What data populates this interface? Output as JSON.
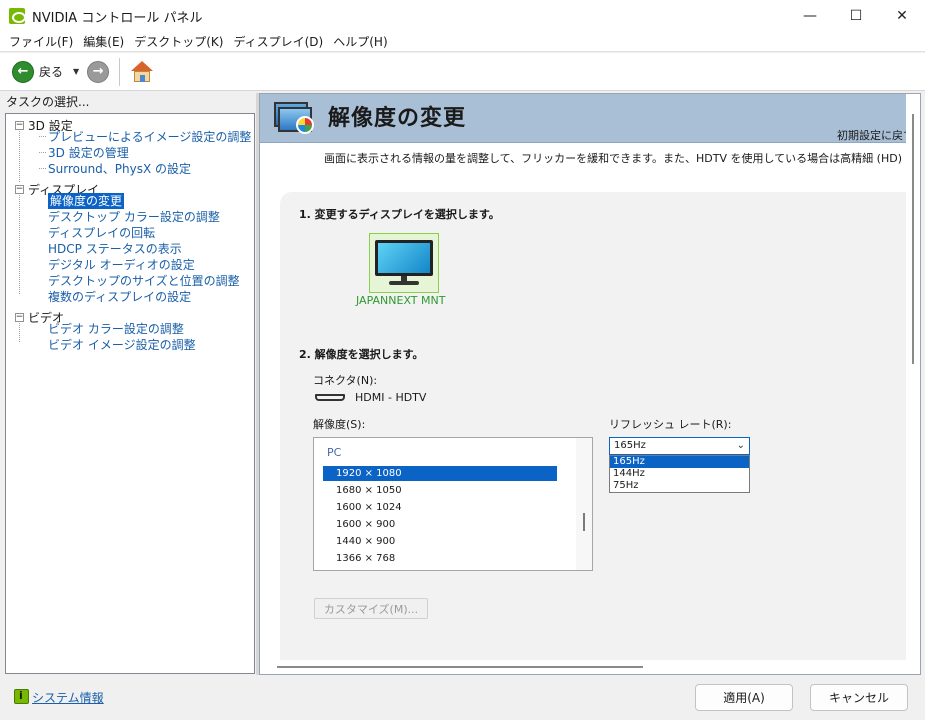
{
  "window": {
    "title": "NVIDIA コントロール パネル",
    "minimize": "—",
    "maximize": "☐",
    "close": "✕"
  },
  "menu": [
    "ファイル(F)",
    "編集(E)",
    "デスクトップ(K)",
    "ディスプレイ(D)",
    "ヘルプ(H)"
  ],
  "toolbar": {
    "back_label": "戻る",
    "back_arrow": "←",
    "forward_arrow": "→",
    "dropdown_caret": "▼"
  },
  "left_panel": {
    "header": "タスクの選択...",
    "groups": [
      {
        "label": "3D 設定",
        "expander": "−",
        "items": [
          "プレビューによるイメージ設定の調整",
          "3D 設定の管理",
          "Surround、PhysX の設定"
        ]
      },
      {
        "label": "ディスプレイ",
        "expander": "−",
        "items": [
          "解像度の変更",
          "デスクトップ カラー設定の調整",
          "ディスプレイの回転",
          "HDCP ステータスの表示",
          "デジタル オーディオの設定",
          "デスクトップのサイズと位置の調整",
          "複数のディスプレイの設定"
        ]
      },
      {
        "label": "ビデオ",
        "expander": "−",
        "items": [
          "ビデオ カラー設定の調整",
          "ビデオ イメージ設定の調整"
        ]
      }
    ],
    "selected_item": "解像度の変更"
  },
  "page": {
    "title": "解像度の変更",
    "restore_defaults": "初期設定に戻す",
    "description": "画面に表示される情報の量を調整して、フリッカーを緩和できます。また、HDTV を使用している場合は高精細 (HD) 方式を選",
    "step1": "1. 変更するディスプレイを選択します。",
    "display_name": "JAPANNEXT MNT",
    "step2": "2. 解像度を選択します。",
    "connector_label": "コネクタ(N):",
    "connector_value": "HDMI - HDTV",
    "resolution_label": "解像度(S):",
    "resolution_group": "PC",
    "resolutions": [
      "1920 × 1080",
      "1680 × 1050",
      "1600 × 1024",
      "1600 × 900",
      "1440 × 900",
      "1366 × 768"
    ],
    "selected_resolution": "1920 × 1080",
    "refresh_label": "リフレッシュ レート(R):",
    "refresh_value": "165Hz",
    "refresh_caret": "⌄",
    "refresh_options": [
      "165Hz",
      "144Hz",
      "75Hz"
    ],
    "customize_button": "カスタマイズ(M)..."
  },
  "bottom": {
    "system_info": "システム情報",
    "apply_button": "適用(A)",
    "cancel_button": "キャンセル"
  },
  "colors": {
    "nvidia_green": "#76b900",
    "selection_blue": "#0b63c6",
    "link_blue": "#1a5fa8",
    "banner_blue": "#a9bfd6"
  }
}
